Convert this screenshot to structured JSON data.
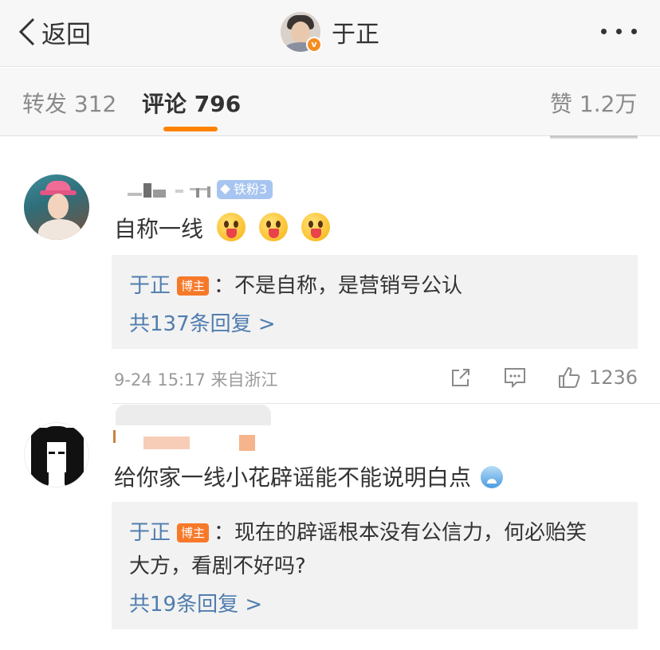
{
  "topbar": {
    "back_label": "返回",
    "user_name": "于正",
    "verified_mark": "v"
  },
  "tabs": [
    {
      "label": "转发 312",
      "active": false
    },
    {
      "label": "评论 796",
      "active": true
    },
    {
      "label": "赞 1.2万",
      "active": false
    }
  ],
  "comments": [
    {
      "fan_badge": "铁粉3",
      "text": "自称一线",
      "emojis": [
        "tongue-out-emoji",
        "tongue-out-emoji",
        "tongue-out-emoji"
      ],
      "reply": {
        "author": "于正",
        "badge": "博主",
        "text_line1": "：不是自称，是营销号公认",
        "text_line2": "",
        "count_label": "共137条回复 >"
      },
      "meta": "9-24 15:17  来自浙江",
      "likes": "1236"
    },
    {
      "text": "给你家一线小花辟谣能不能说明白点",
      "emojis": [
        "weary-emoji"
      ],
      "reply": {
        "author": "于正",
        "badge": "博主",
        "text_line1": "：现在的辟谣根本没有公信力，何必贻笑",
        "text_line2": "大方，看剧不好吗?",
        "count_label": "共19条回复 >"
      }
    }
  ],
  "colors": {
    "accent_orange": "#ff8200",
    "link_blue": "#507daf",
    "blogger_badge": "#f6792a",
    "fan_badge": "#a7c5f0"
  }
}
